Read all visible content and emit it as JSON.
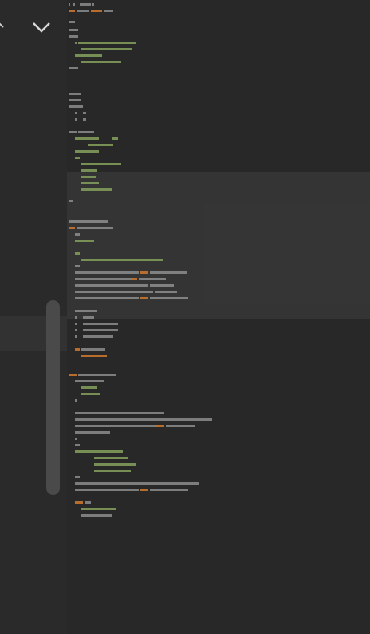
{
  "editor": {
    "collapse_icon": "chevron-up-icon",
    "expand_icon": "chevron-down-icon"
  },
  "colors": {
    "background": "#282828",
    "side_panel": "#2a2a2a",
    "scrollbar_thumb": "#4a4a4a",
    "text": "#9a9a9a",
    "green": "#7f9a5a",
    "orange": "#c8742e",
    "blue": "#7f95b5"
  }
}
